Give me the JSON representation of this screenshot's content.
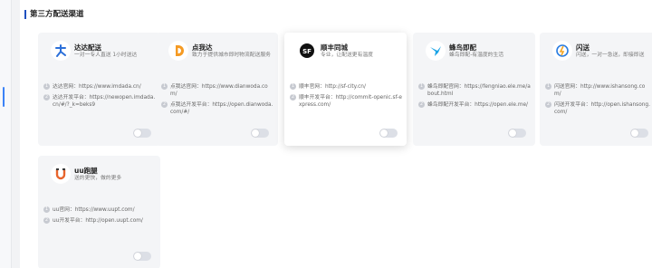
{
  "section": {
    "title": "第三方配送渠道"
  },
  "colors": {
    "accent": "#1f4fbf",
    "toggle_off": "#dcdfe6"
  },
  "cards": [
    {
      "name": "达达配送",
      "desc": "一对一专人直送 1小时送达",
      "logo_icon": "dada-logo-icon",
      "logo_color": "#2b6fd9",
      "lines": [
        {
          "num": "1",
          "text": "达达官网：https://www.imdada.cn/"
        },
        {
          "num": "2",
          "text": "达达开发平台：https://newopen.imdada.cn/#/?_k=beks9"
        }
      ],
      "enabled": false
    },
    {
      "name": "点我达",
      "desc": "致力于提供城市即时物流配送服务",
      "logo_icon": "dianwoda-logo-icon",
      "logo_color": "#f59a23",
      "lines": [
        {
          "num": "1",
          "text": "点我达官网：https://www.dianwoda.com/"
        },
        {
          "num": "2",
          "text": "点我达开发平台：https://open.dianwoda.com/#/"
        }
      ],
      "enabled": false
    },
    {
      "name": "顺丰同城",
      "desc": "专业，让配送更有温度",
      "logo_icon": "sf-logo-icon",
      "logo_color": "#111111",
      "lines": [
        {
          "num": "1",
          "text": "顺丰官网：http://sf-city.cn/"
        },
        {
          "num": "2",
          "text": "顺丰开发平台：http://commit-openic.sf-express.com/"
        }
      ],
      "enabled": false
    },
    {
      "name": "蜂鸟即配",
      "desc": "蜂鸟即配-有温度的生活",
      "logo_icon": "fengniao-logo-icon",
      "logo_color": "#1aa3e6",
      "lines": [
        {
          "num": "1",
          "text": "蜂鸟即配官网：https://fengniao.ele.me/about.html"
        },
        {
          "num": "2",
          "text": "蜂鸟即配开发平台：https://open.ele.me/"
        }
      ],
      "enabled": false
    },
    {
      "name": "闪送",
      "desc": "闪送，一对一急送，即接即送",
      "logo_icon": "shansong-logo-icon",
      "logo_color": "#2a7de1",
      "lines": [
        {
          "num": "1",
          "text": "闪送官网：http://www.ishansong.com/"
        },
        {
          "num": "2",
          "text": "闪送开发平台：http://open.ishansong.com/"
        }
      ],
      "enabled": false
    },
    {
      "name": "uu跑腿",
      "desc": "送的更快，做的更多",
      "logo_icon": "uupt-logo-icon",
      "logo_color": "#e8642c",
      "lines": [
        {
          "num": "1",
          "text": "uu官网：https://www.uupt.com/"
        },
        {
          "num": "2",
          "text": "uu开发平台：http://open.uupt.com/"
        }
      ],
      "enabled": false
    }
  ]
}
